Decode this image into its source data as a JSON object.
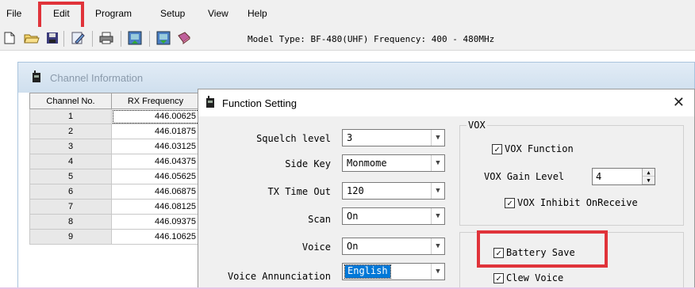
{
  "menu": {
    "file": "File",
    "edit": "Edit",
    "program": "Program",
    "setup": "Setup",
    "view": "View",
    "help": "Help"
  },
  "toolbar": {
    "icons": [
      "new-file-icon",
      "open-folder-icon",
      "save-icon",
      "edit-icon",
      "print-icon",
      "read-from-radio-icon",
      "write-to-radio-icon",
      "book-icon"
    ],
    "model_info": "Model Type: BF-480(UHF)  Frequency: 400 - 480MHz"
  },
  "channel_window": {
    "title": "Channel Information",
    "columns": [
      "Channel No.",
      "RX Frequency"
    ],
    "rows": [
      {
        "no": "1",
        "rx": "446.00625"
      },
      {
        "no": "2",
        "rx": "446.01875"
      },
      {
        "no": "3",
        "rx": "446.03125"
      },
      {
        "no": "4",
        "rx": "446.04375"
      },
      {
        "no": "5",
        "rx": "446.05625"
      },
      {
        "no": "6",
        "rx": "446.06875"
      },
      {
        "no": "7",
        "rx": "446.08125"
      },
      {
        "no": "8",
        "rx": "446.09375"
      },
      {
        "no": "9",
        "rx": "446.10625"
      }
    ]
  },
  "dialog": {
    "title": "Function Setting",
    "close": "✕",
    "fields": {
      "squelch_label": "Squelch level",
      "squelch_value": "3",
      "sidekey_label": "Side Key",
      "sidekey_value": "Monmome",
      "txtimeout_label": "TX Time Out",
      "txtimeout_value": "120",
      "scan_label": "Scan",
      "scan_value": "On",
      "voice_label": "Voice",
      "voice_value": "On",
      "annunciation_label": "Voice Annunciation",
      "annunciation_value": "English"
    },
    "vox": {
      "legend": "VOX",
      "vox_function": "VOX Function",
      "gain_label": "VOX Gain Level",
      "gain_value": "4",
      "inhibit": "VOX Inhibit OnReceive"
    },
    "options": {
      "battery_save": "Battery Save",
      "clew_voice": "Clew Voice"
    }
  },
  "colors": {
    "highlight": "#e0333a",
    "selection": "#0078d7"
  }
}
